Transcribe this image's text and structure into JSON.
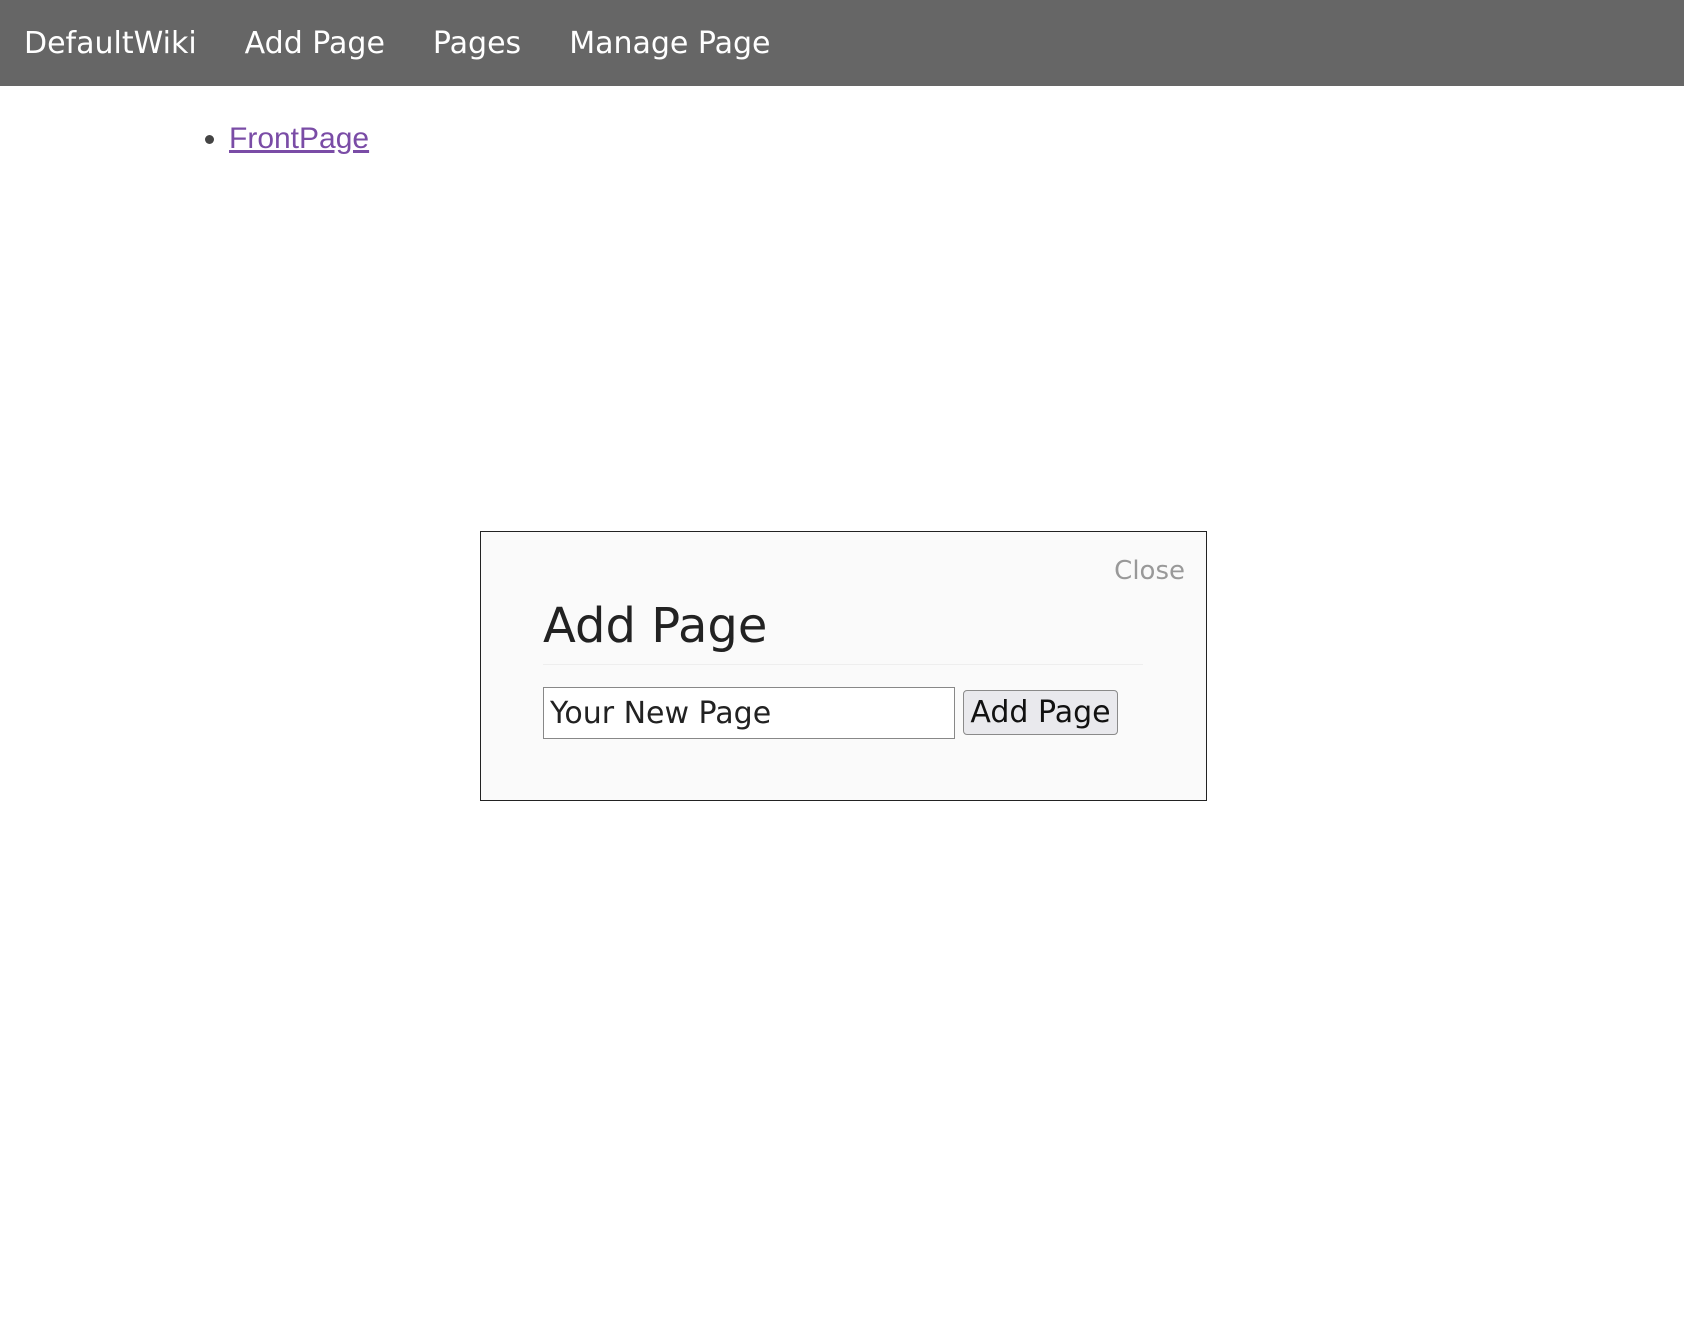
{
  "nav": {
    "brand": "DefaultWiki",
    "add_page": "Add Page",
    "pages": "Pages",
    "manage_page": "Manage Page"
  },
  "pages_list": [
    {
      "label": "FrontPage"
    }
  ],
  "modal": {
    "close_label": "Close",
    "title": "Add Page",
    "input_value": "Your New Page",
    "submit_label": "Add Page"
  },
  "colors": {
    "navbar_bg": "#666666",
    "link_visited": "#7a4ca6",
    "modal_bg": "#fafafa"
  }
}
